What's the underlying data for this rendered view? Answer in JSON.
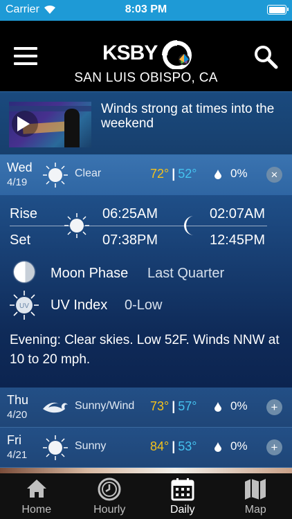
{
  "status": {
    "carrier": "Carrier",
    "time": "8:03 PM"
  },
  "header": {
    "logo": "KSBY",
    "location": "SAN LUIS OBISPO, CA"
  },
  "video": {
    "headline": "Winds strong at times into the weekend"
  },
  "days": [
    {
      "day": "Wed",
      "date": "4/19",
      "condition": "Clear",
      "icon": "sun-icon",
      "high": "72°",
      "low": "52°",
      "precip": "0%",
      "toggle": "×"
    },
    {
      "day": "Thu",
      "date": "4/20",
      "condition": "Sunny/Wind",
      "icon": "wind-icon",
      "high": "73°",
      "low": "57°",
      "precip": "0%",
      "toggle": "+"
    },
    {
      "day": "Fri",
      "date": "4/21",
      "condition": "Sunny",
      "icon": "sun-icon",
      "high": "84°",
      "low": "53°",
      "precip": "0%",
      "toggle": "+"
    }
  ],
  "detail": {
    "rise_label": "Rise",
    "set_label": "Set",
    "sunrise": "06:25AM",
    "sunset": "07:38PM",
    "moonrise": "02:07AM",
    "moonset": "12:45PM",
    "moon_phase_label": "Moon Phase",
    "moon_phase": "Last Quarter",
    "uv_label": "UV Index",
    "uv_value": "0-Low",
    "uv_badge": "UV",
    "description": "Evening: Clear skies. Low 52F. Winds NNW at 10 to 20 mph."
  },
  "tabs": [
    {
      "label": "Home",
      "icon": "home-icon"
    },
    {
      "label": "Hourly",
      "icon": "clock-icon"
    },
    {
      "label": "Daily",
      "icon": "calendar-icon",
      "active": true
    },
    {
      "label": "Map",
      "icon": "map-icon"
    }
  ],
  "colors": {
    "status_bar": "#1e9ad6",
    "high_temp": "#f5c21a",
    "low_temp": "#45c3f0",
    "row_bg": "#234f86"
  }
}
